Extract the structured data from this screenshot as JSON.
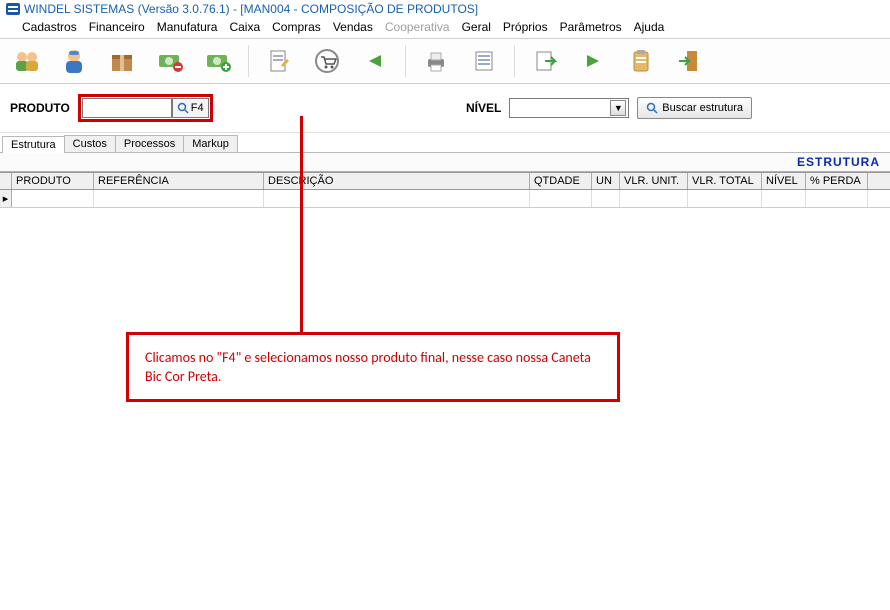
{
  "window": {
    "title": "WINDEL SISTEMAS (Versão 3.0.76.1) - [MAN004 - COMPOSIÇÃO DE PRODUTOS]"
  },
  "menu": {
    "items": [
      "Cadastros",
      "Financeiro",
      "Manufatura",
      "Caixa",
      "Compras",
      "Vendas",
      "Cooperativa",
      "Geral",
      "Próprios",
      "Parâmetros",
      "Ajuda"
    ],
    "disabled_index": 6
  },
  "toolbar": {
    "icons": [
      "users-icon",
      "person-icon",
      "package-icon",
      "money-remove-icon",
      "money-add-icon",
      "doc-edit-icon",
      "cart-icon",
      "arrow-left-green-icon",
      "printer-icon",
      "sheet-icon",
      "sheet-arrow-icon",
      "arrow-right-green-icon",
      "clipboard-icon",
      "exit-door-icon"
    ]
  },
  "filter": {
    "produto_label": "PRODUTO",
    "produto_value": "",
    "f4_label": "F4",
    "nivel_label": "NÍVEL",
    "nivel_value": "",
    "buscar_label": "Buscar estrutura"
  },
  "tabs": {
    "items": [
      "Estrutura",
      "Custos",
      "Processos",
      "Markup"
    ],
    "active_index": 0
  },
  "grid": {
    "title": "ESTRUTURA",
    "columns": [
      "PRODUTO",
      "REFERÊNCIA",
      "DESCRIÇÃO",
      "QTDADE",
      "UN",
      "VLR. UNIT.",
      "VLR. TOTAL",
      "NÍVEL",
      "% PERDA"
    ],
    "rows": []
  },
  "annotation": {
    "text": "Clicamos no \"F4\" e selecionamos nosso produto final, nesse caso nossa Caneta Bic Cor Preta."
  }
}
